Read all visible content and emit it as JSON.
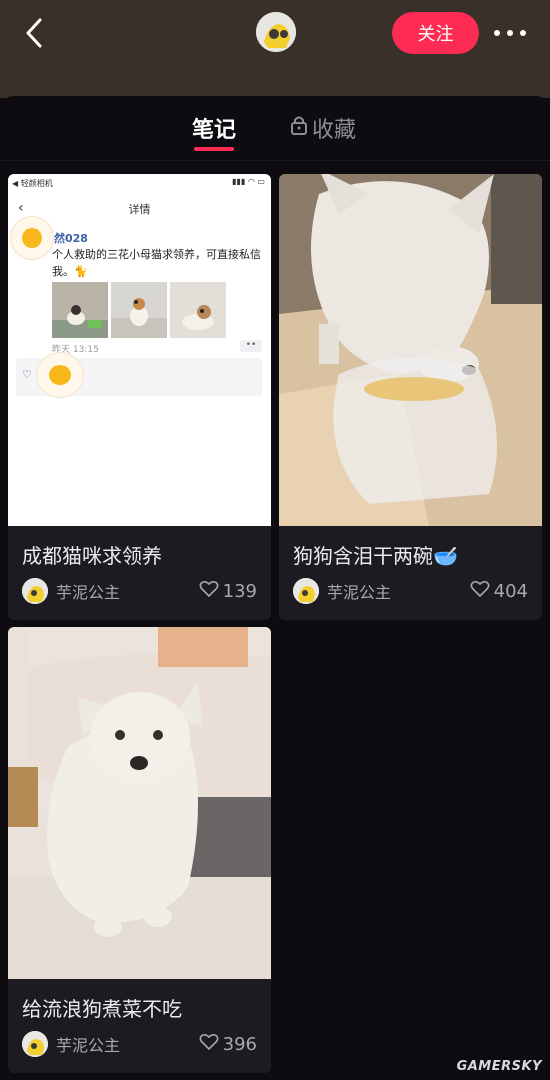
{
  "header": {
    "follow_label": "关注",
    "accent": "#fe2c55"
  },
  "tabs": {
    "notes": "笔记",
    "favorites": "收藏"
  },
  "notes": [
    {
      "title": "成都猫咪求领养",
      "author": "芋泥公主",
      "likes": "139",
      "cover": {
        "status_left": "◀ 轻颜相机",
        "nav_title": "详情",
        "user": "然028",
        "text": "个人救助的三花小母猫求领养，可直接私信我。🐈",
        "time": "昨天 13:15",
        "dots": "••"
      }
    },
    {
      "title": "狗狗含泪干两碗🥣",
      "author": "芋泥公主",
      "likes": "404"
    },
    {
      "title": "给流浪狗煮菜不吃",
      "author": "芋泥公主",
      "likes": "396"
    }
  ],
  "watermark": "GAMERSKY"
}
